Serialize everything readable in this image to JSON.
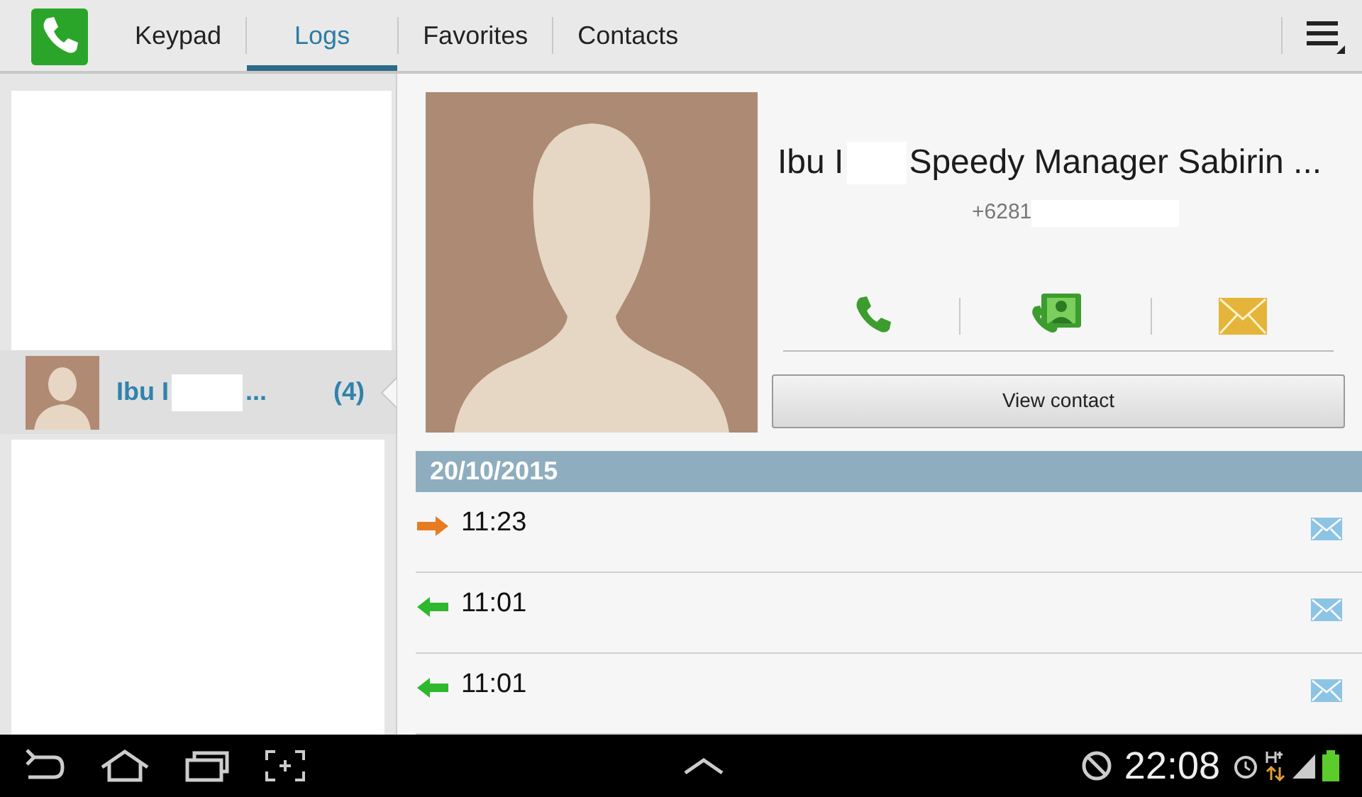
{
  "app_bar": {
    "tabs": [
      {
        "label": "Keypad",
        "selected": false
      },
      {
        "label": "Logs",
        "selected": true
      },
      {
        "label": "Favorites",
        "selected": false
      },
      {
        "label": "Contacts",
        "selected": false
      }
    ]
  },
  "log_list": {
    "items": [
      {
        "name": "Ibu I",
        "name_end": "...",
        "count": "(4)",
        "selected": true
      }
    ]
  },
  "contact": {
    "name_start": "Ibu I",
    "name_end": "Speedy Manager Sabirin ...",
    "phone": "+6281",
    "view_button": "View contact"
  },
  "history": {
    "date": "20/10/2015",
    "calls": [
      {
        "time": "11:23",
        "kind": "outgoing"
      },
      {
        "time": "11:01",
        "kind": "incoming"
      },
      {
        "time": "11:01",
        "kind": "incoming"
      }
    ]
  },
  "status_bar": {
    "time": "22:08"
  }
}
